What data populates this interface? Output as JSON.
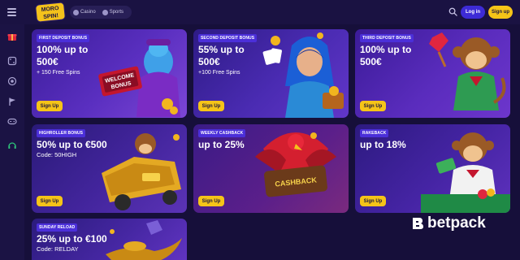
{
  "topbar": {
    "logo_line1": "MORO",
    "logo_line2": "SPIN!",
    "nav_casino": "Casino",
    "nav_sports": "Sports",
    "login_label": "Log in",
    "signup_label": "Sign up"
  },
  "sidebar": {
    "icons": [
      "gift-icon",
      "dice-icon",
      "live-icon",
      "sports-icon",
      "gamepad-icon",
      "headset-icon"
    ]
  },
  "cards": [
    {
      "badge": "First deposit bonus",
      "line1": "100% up to",
      "line2": "500€",
      "sub": "+ 150 Free Spins",
      "button": "Sign Up"
    },
    {
      "badge": "Second deposit bonus",
      "line1": "55% up to",
      "line2": "500€",
      "sub": "+100 Free Spins",
      "button": "Sign Up"
    },
    {
      "badge": "Third deposit bonus",
      "line1": "100% up to",
      "line2": "500€",
      "sub": "",
      "button": "Sign Up"
    },
    {
      "badge": "Highroller bonus",
      "line1": "50% up to €500",
      "line2": "",
      "sub": "Code: 50HIGH",
      "button": "Sign Up"
    },
    {
      "badge": "Weekly cashback",
      "line1": "up to 25%",
      "line2": "",
      "sub": "",
      "button": "Sign Up",
      "art_text": "CASHBACK"
    },
    {
      "badge": "Rakeback",
      "line1": "up to 18%",
      "line2": "",
      "sub": "",
      "button": "Sign Up"
    },
    {
      "badge": "Sunday reload",
      "line1": "25% up to €100",
      "line2": "",
      "sub": "Code: RELDAY",
      "button": ""
    }
  ],
  "art": {
    "welcome_sign_line1": "WELCOME",
    "welcome_sign_line2": "BONUS"
  },
  "watermark": "betpack",
  "colors": {
    "background": "#160f3a",
    "accent_yellow": "#f5c418",
    "badge_blue": "#4b2fd9",
    "login_blue": "#3d2bd6"
  }
}
